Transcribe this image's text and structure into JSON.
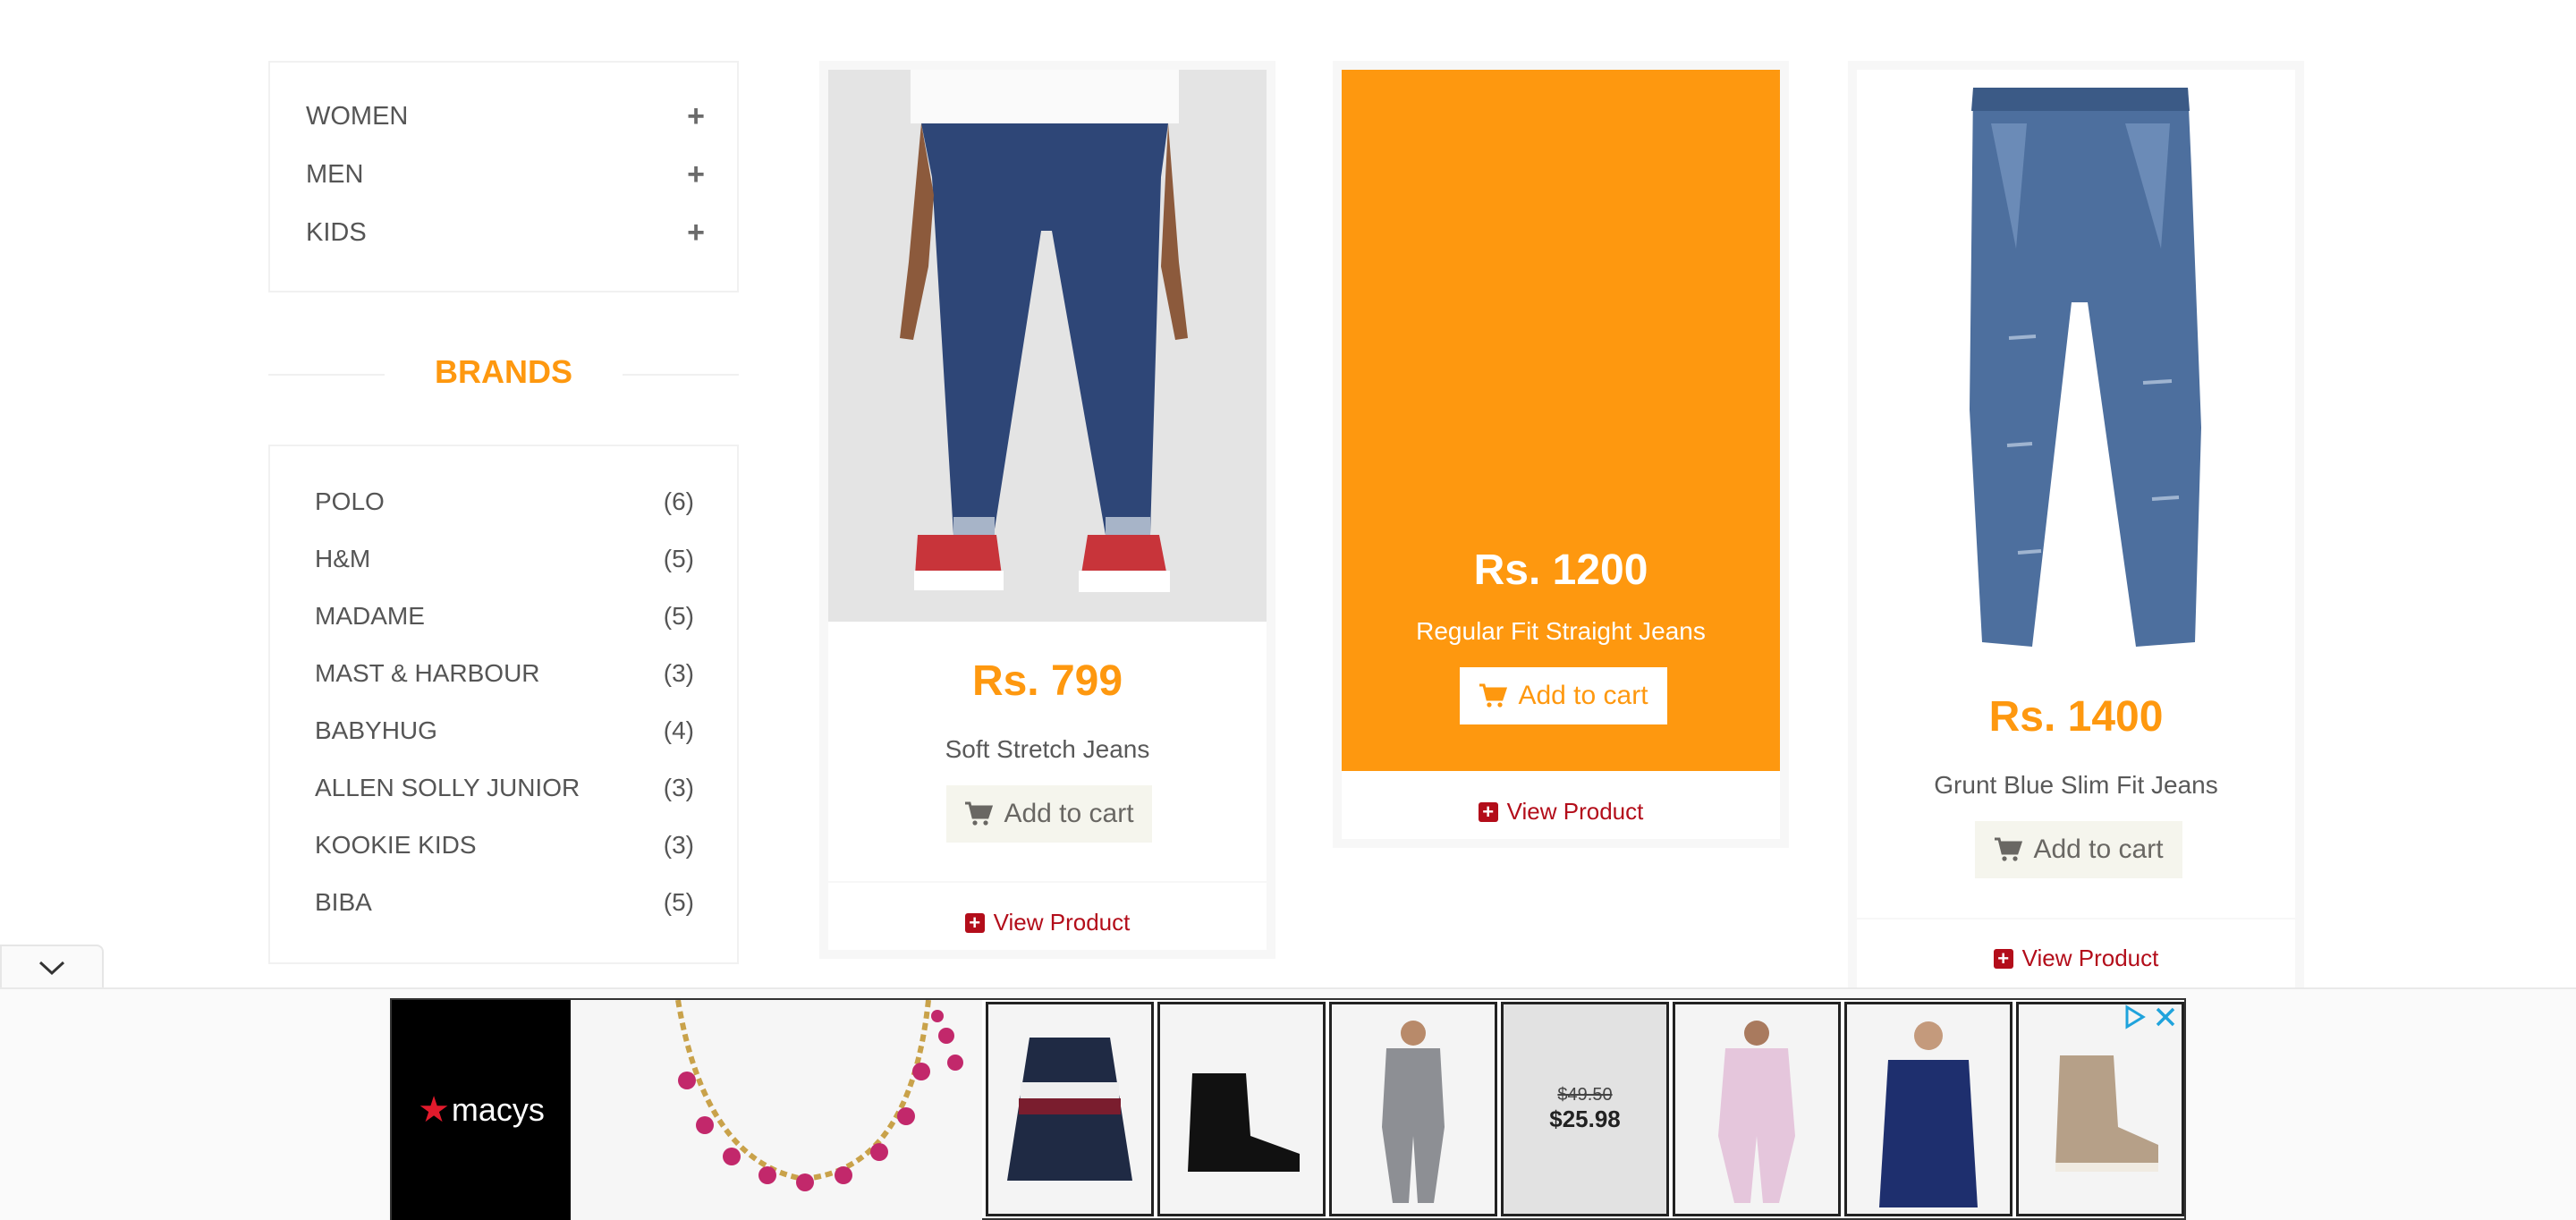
{
  "categories": [
    {
      "label": "WOMEN"
    },
    {
      "label": "MEN"
    },
    {
      "label": "KIDS"
    }
  ],
  "brands_title": "BRANDS",
  "brands": [
    {
      "name": "POLO",
      "count": "(6)"
    },
    {
      "name": "H&M",
      "count": "(5)"
    },
    {
      "name": "MADAME",
      "count": "(5)"
    },
    {
      "name": "MAST & HARBOUR",
      "count": "(3)"
    },
    {
      "name": "BABYHUG",
      "count": "(4)"
    },
    {
      "name": "ALLEN SOLLY JUNIOR",
      "count": "(3)"
    },
    {
      "name": "KOOKIE KIDS",
      "count": "(3)"
    },
    {
      "name": "BIBA",
      "count": "(5)"
    }
  ],
  "products": [
    {
      "price": "Rs. 799",
      "name": "Soft Stretch Jeans",
      "cart_label": "Add to cart",
      "view_label": "View Product"
    },
    {
      "price": "Rs. 1200",
      "name": "Regular Fit Straight Jeans",
      "cart_label": "Add to cart",
      "view_label": "View Product"
    },
    {
      "price": "Rs. 1400",
      "name": "Grunt Blue Slim Fit Jeans",
      "cart_label": "Add to cart",
      "view_label": "View Product"
    }
  ],
  "ad": {
    "brand": "macys",
    "old_price": "$49.50",
    "new_price": "$25.98",
    "tiles": [
      "sweater-image",
      "boot-image",
      "grey-suit-image",
      "shirt-image",
      "pink-suit-image",
      "blouse-image",
      "chelsea-boot-image"
    ]
  },
  "colors": {
    "accent": "#fe980f",
    "link": "#b30d1a",
    "text": "#555555"
  },
  "icons": [
    "plus-icon",
    "cart-icon",
    "plus-square-icon",
    "chevron-down-icon",
    "adchoices-icon",
    "close-icon"
  ]
}
